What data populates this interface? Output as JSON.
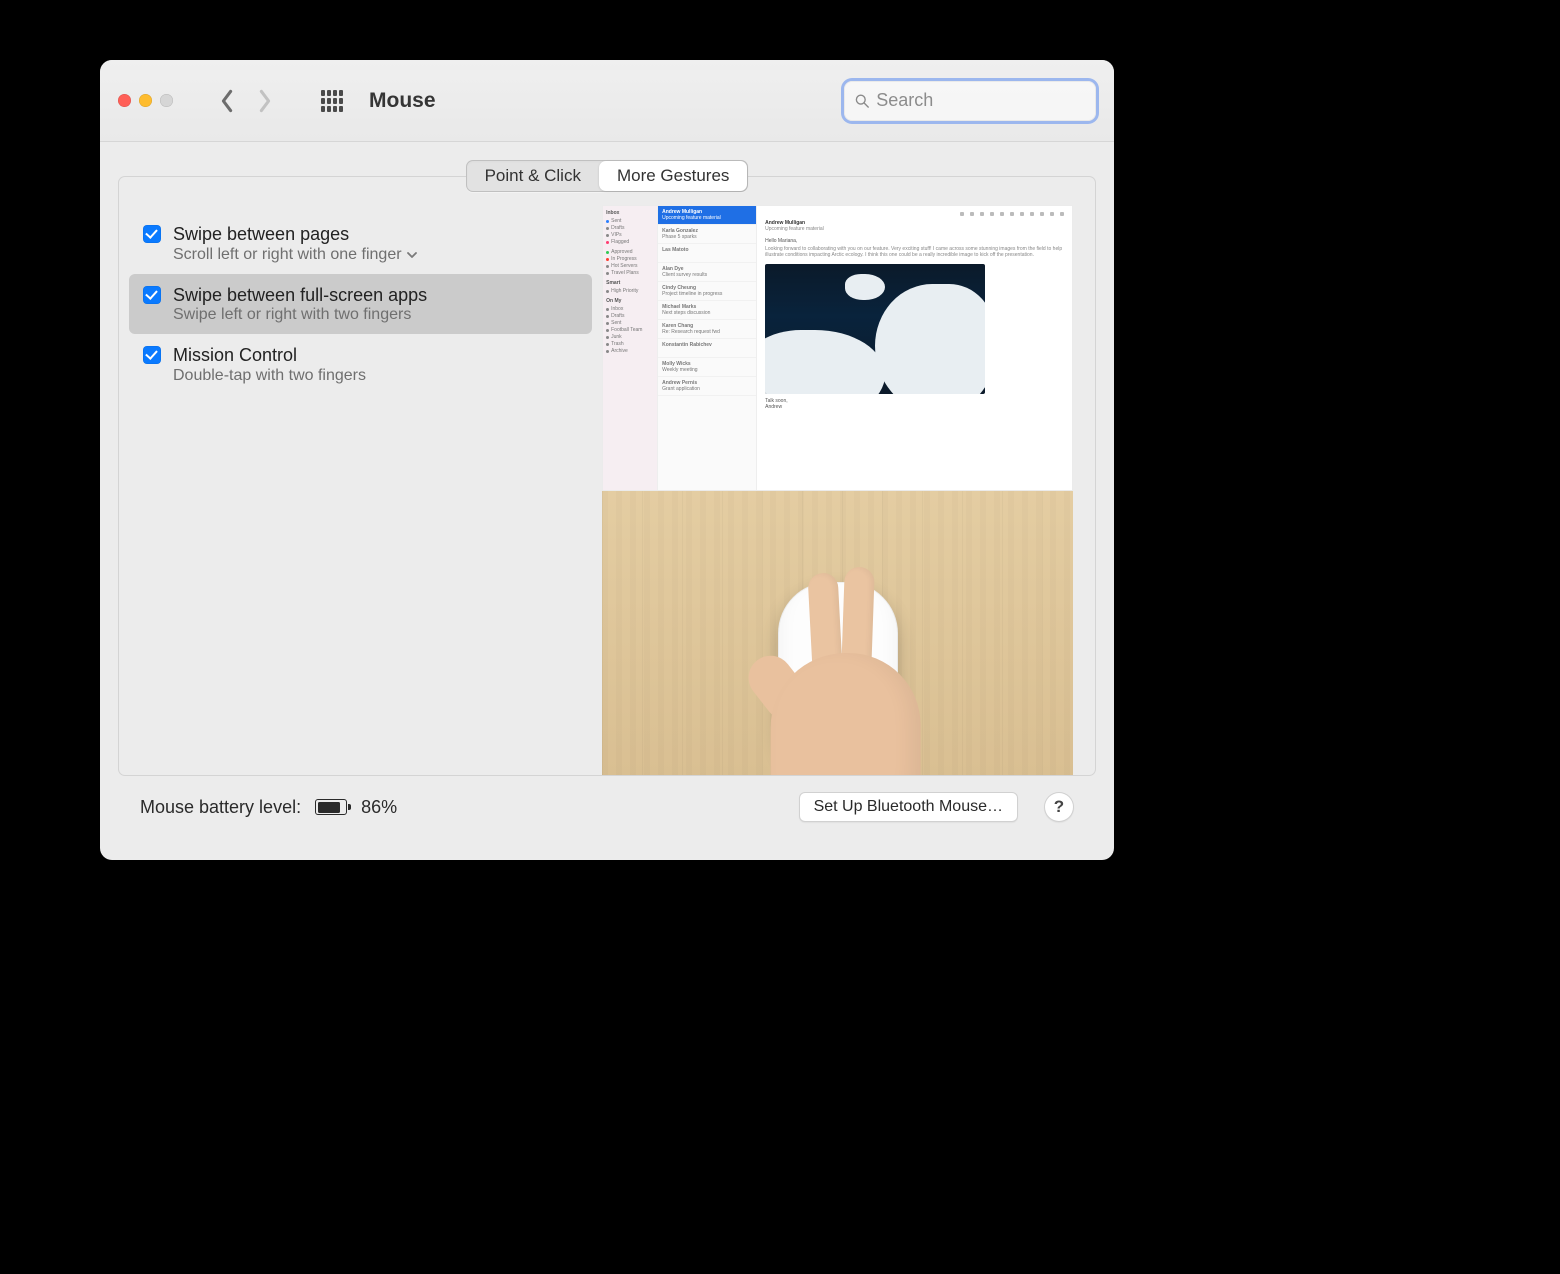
{
  "window": {
    "title": "Mouse"
  },
  "search": {
    "placeholder": "Search",
    "value": ""
  },
  "tabs": {
    "items": [
      "Point & Click",
      "More Gestures"
    ],
    "active": 1
  },
  "gestures": [
    {
      "title": "Swipe between pages",
      "sub": "Scroll left or right with one finger",
      "checked": true,
      "hasDropdown": true
    },
    {
      "title": "Swipe between full-screen apps",
      "sub": "Swipe left or right with two fingers",
      "checked": true,
      "hasDropdown": false,
      "selected": true
    },
    {
      "title": "Mission Control",
      "sub": "Double-tap with two fingers",
      "checked": true,
      "hasDropdown": false
    }
  ],
  "battery": {
    "label": "Mouse battery level:",
    "percent": 86
  },
  "footer": {
    "setup": "Set Up Bluetooth Mouse…",
    "help": "?"
  },
  "preview": {
    "mailbox": [
      "Inbox",
      "Sent",
      "Drafts",
      "VIPs",
      "Flagged"
    ],
    "mailtags": [
      "Approved",
      "In Progress",
      "Hot Servers",
      "Travel Plans"
    ],
    "smart": [
      "High Priority"
    ],
    "onmac": [
      "Inbox",
      "Drafts",
      "Sent",
      "Football Team",
      "Junk",
      "Trash",
      "Archive"
    ],
    "threads": [
      {
        "n": "Andrew Mulligan",
        "s": "Upcoming feature material",
        "sel": true
      },
      {
        "n": "Karla Gonzalez",
        "s": "Phase 5 sparks"
      },
      {
        "n": "Las Matoto",
        "s": ""
      },
      {
        "n": "Alan Dye",
        "s": "Client survey results"
      },
      {
        "n": "Cindy Cheung",
        "s": "Project timeline in progress"
      },
      {
        "n": "Michael Marks",
        "s": "Next steps discussion"
      },
      {
        "n": "Karen Chang",
        "s": "Re: Research request fwd"
      },
      {
        "n": "Konstantin Rabichev",
        "s": ""
      },
      {
        "n": "Molly Wicks",
        "s": "Weekly meeting"
      },
      {
        "n": "Andrew Pernis",
        "s": "Grant application"
      }
    ],
    "sender": "Andrew Mulligan",
    "subject": "Upcoming feature material",
    "greeting": "Hello Mariana,",
    "caption": "Talk soon,\nAndrew"
  }
}
